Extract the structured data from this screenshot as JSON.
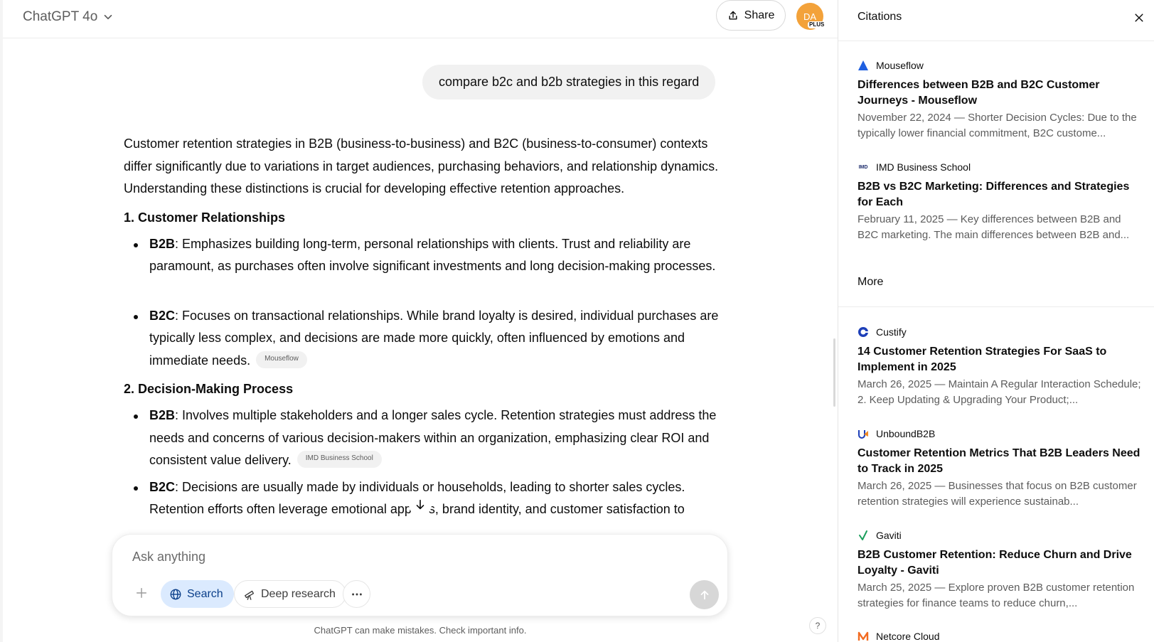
{
  "header": {
    "model_name": "ChatGPT 4o",
    "share_label": "Share",
    "avatar_initials": "DA",
    "avatar_badge": "PLUS"
  },
  "conversation": {
    "user_message": "compare b2c and b2b strategies in this regard",
    "intro": "Customer retention strategies in B2B (business-to-business) and B2C (business-to-consumer) contexts differ significantly due to variations in target audiences, purchasing behaviors, and relationship dynamics. Understanding these distinctions is crucial for developing effective retention approaches.",
    "sections": [
      {
        "heading": "1. Customer Relationships",
        "b2b_label": "B2B",
        "b2b_text": ": Emphasizes building long-term, personal relationships with clients. Trust and reliability are paramount, as purchases often involve significant investments and long decision-making processes.",
        "b2c_label": "B2C",
        "b2c_text": ": Focuses on transactional relationships. While brand loyalty is desired, individual purchases are typically less complex, and decisions are made more quickly, often influenced by emotions and immediate needs.",
        "b2c_chip": "Mouseflow"
      },
      {
        "heading": "2. Decision-Making Process",
        "b2b_label": "B2B",
        "b2b_text": ": Involves multiple stakeholders and a longer sales cycle. Retention strategies must address the needs and concerns of various decision-makers within an organization, emphasizing clear ROI and consistent value delivery.",
        "b2b_chip": "IMD Business School",
        "b2c_label": "B2C",
        "b2c_text": ": Decisions are usually made by individuals or households, leading to shorter sales cycles.",
        "b2c_cutoff": "Retention efforts often leverage emotional appeals, brand identity, and customer satisfaction to"
      }
    ]
  },
  "composer": {
    "placeholder": "Ask anything",
    "search_label": "Search",
    "deep_research_label": "Deep research"
  },
  "disclaimer": "ChatGPT can make mistakes. Check important info.",
  "help_label": "?",
  "citations": {
    "title": "Citations",
    "more_label": "More",
    "items": [
      {
        "source": "Mouseflow",
        "title": "Differences between B2B and B2C Customer Journeys - Mouseflow",
        "snippet": "November 22, 2024 — Shorter Decision Cycles: Due to the typically lower financial commitment, B2C custome..."
      },
      {
        "source": "IMD Business School",
        "title": "B2B vs B2C Marketing: Differences and Strategies for Each",
        "snippet": "February 11, 2025 — Key differences between B2B and B2C marketing. The main differences between B2B and..."
      },
      {
        "source": "Custify",
        "title": "14 Customer Retention Strategies For SaaS to Implement in 2025",
        "snippet": "March 26, 2025 — Maintain A Regular Interaction Schedule; 2. Keep Updating & Upgrading Your Product;..."
      },
      {
        "source": "UnboundB2B",
        "title": "Customer Retention Metrics That B2B Leaders Need to Track in 2025",
        "snippet": "March 26, 2025 — Businesses that focus on B2B customer retention strategies will experience sustainab..."
      },
      {
        "source": "Gaviti",
        "title": "B2B Customer Retention: Reduce Churn and Drive Loyalty - Gaviti",
        "snippet": "March 25, 2025 — Explore proven B2B customer retention strategies for finance teams to reduce churn,..."
      },
      {
        "source": "Netcore Cloud",
        "title": "",
        "snippet": ""
      }
    ]
  },
  "colors": {
    "accent_blue": "#1d4ed8",
    "avatar_orange": "#f3a23a",
    "bubble_gray": "#f1f1f1"
  },
  "icons": [
    "chevron-down-icon",
    "share-icon",
    "scroll-down-arrow-icon",
    "plus-icon",
    "globe-icon",
    "telescope-icon",
    "more-dots-icon",
    "send-arrow-icon",
    "close-icon"
  ]
}
